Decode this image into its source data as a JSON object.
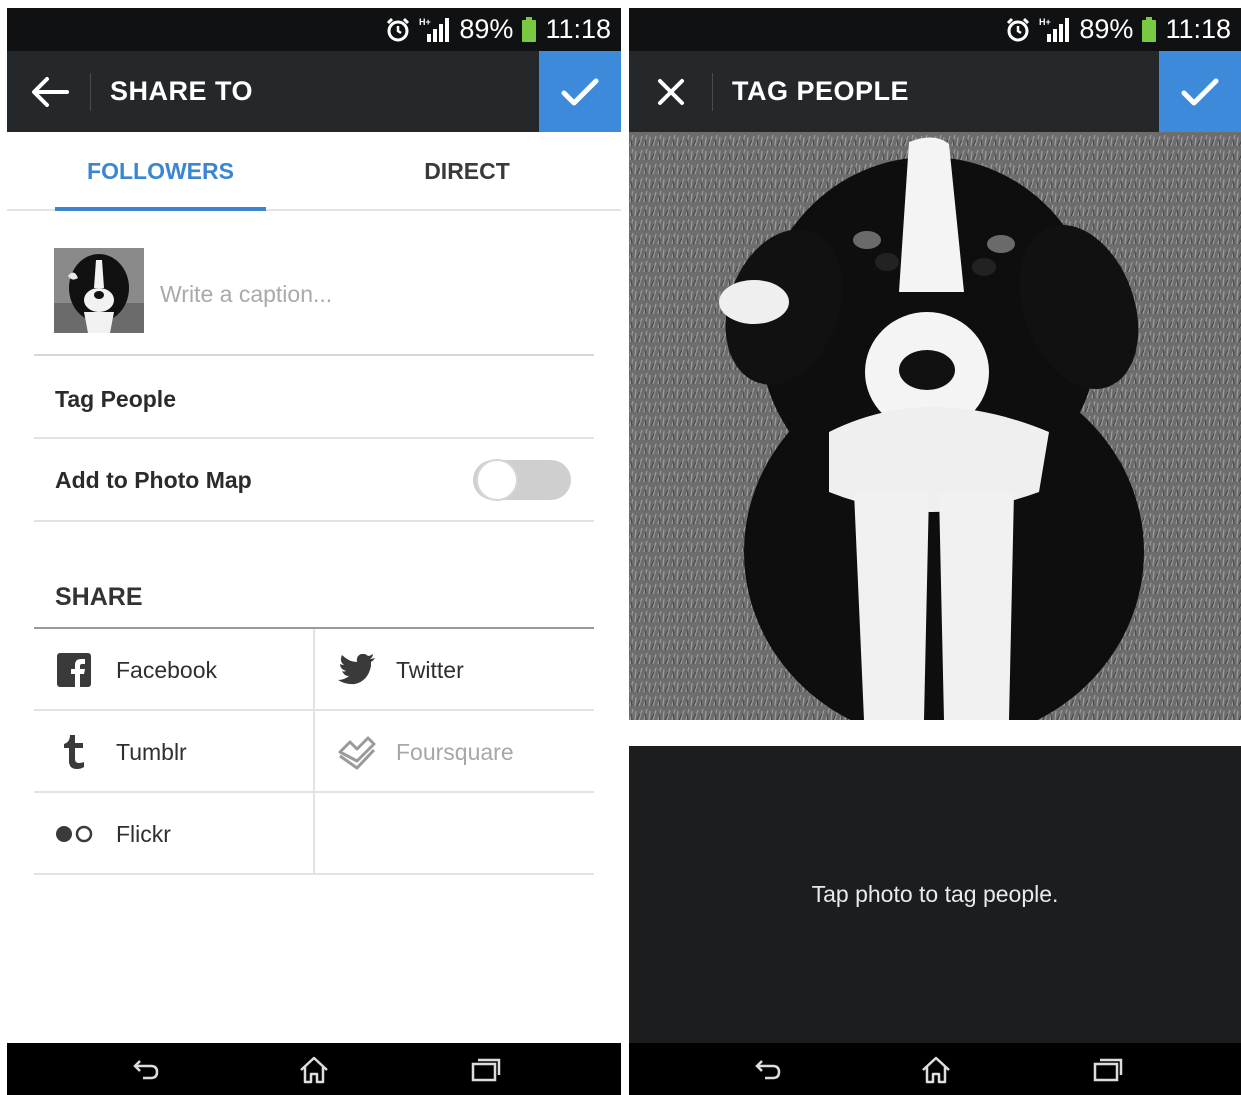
{
  "status_bar": {
    "battery": "89%",
    "time": "11:18"
  },
  "share_screen": {
    "title": "SHARE TO",
    "tabs": [
      {
        "label": "FOLLOWERS"
      },
      {
        "label": "DIRECT"
      }
    ],
    "caption_placeholder": "Write a caption...",
    "tag_people_label": "Tag People",
    "photo_map_label": "Add to Photo Map",
    "photo_map_enabled": false,
    "share_heading": "SHARE",
    "share_targets": [
      {
        "label": "Facebook",
        "icon": "facebook-icon"
      },
      {
        "label": "Twitter",
        "icon": "twitter-icon"
      },
      {
        "label": "Tumblr",
        "icon": "tumblr-icon"
      },
      {
        "label": "Foursquare",
        "icon": "foursquare-icon",
        "disabled": true
      },
      {
        "label": "Flickr",
        "icon": "flickr-icon"
      }
    ]
  },
  "tag_screen": {
    "title": "TAG PEOPLE",
    "hint": "Tap photo to tag people."
  },
  "colors": {
    "accent": "#3c8ad9",
    "topbar": "#25282b",
    "status_bar": "#101112"
  }
}
